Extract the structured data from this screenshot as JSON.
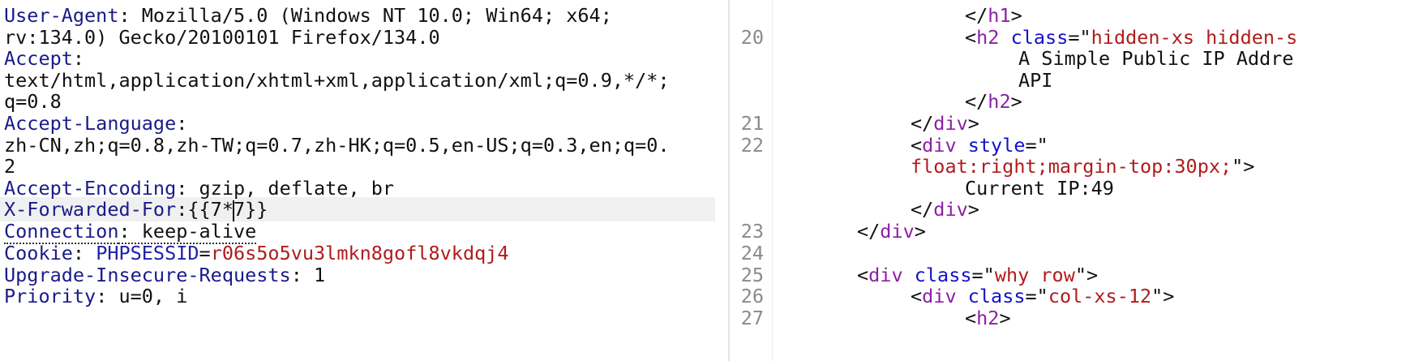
{
  "request": {
    "user_agent_key": "User-Agent",
    "user_agent_val1": ": Mozilla/5.0 (Windows NT 10.0; Win64; x64;",
    "user_agent_val2": "rv:134.0) Gecko/20100101 Firefox/134.0",
    "accept_key": "Accept",
    "accept_colon": ":",
    "accept_val1": "text/html,application/xhtml+xml,application/xml;q=0.9,*/*;",
    "accept_val2": "q=0.8",
    "lang_key": "Accept-Language",
    "lang_colon": ":",
    "lang_val1": "zh-CN,zh;q=0.8,zh-TW;q=0.7,zh-HK;q=0.5,en-US;q=0.3,en;q=0.",
    "lang_val2": "2",
    "enc_key": "Accept-Encoding",
    "enc_val": ": gzip, deflate, br",
    "xff_key": "X-Forwarded-For",
    "xff_val_a": ":{{7*",
    "xff_val_b": "7}}",
    "conn_key": "Connection",
    "conn_val": ": keep-alive",
    "cookie_key": "Cookie",
    "cookie_sep": ": ",
    "cookie_name": "PHPSESSID",
    "cookie_eq": "=",
    "cookie_value": "r06s5o5vu3lmkn8gofl8vkdqj4",
    "upg_key": "Upgrade-Insecure-Requests",
    "upg_val": ": 1",
    "prio_key": "Priority",
    "prio_val": ": u=0, i"
  },
  "response": {
    "line_numbers": [
      "20",
      "21",
      "22",
      "23",
      "24",
      "25",
      "26",
      "27"
    ],
    "t_close_h1_a": "</",
    "t_h1": "h1",
    "t_close_h1_b": ">",
    "t_h2_open_a": "<",
    "t_h2": "h2",
    "t_class_attr": "class",
    "t_eq_q": "=\"",
    "t_h2_class": "hidden-xs hidden-s",
    "t_h2_text1": "A Simple Public IP Addre",
    "t_h2_text2": "API",
    "t_close_h2_a": "</",
    "t_close_h2_b": ">",
    "t_div": "div",
    "t_style_attr": "style",
    "t_style_open": "=\"",
    "t_style_val": "float:right;margin-top:30px;",
    "t_style_close": "\">",
    "t_current_ip": "Current IP:49",
    "t_class_why": "why row",
    "t_class_col": "col-xs-12",
    "t_q_close": "\">",
    "t_lt": "<",
    "t_gt": ">",
    "t_lt_slash": "</"
  }
}
